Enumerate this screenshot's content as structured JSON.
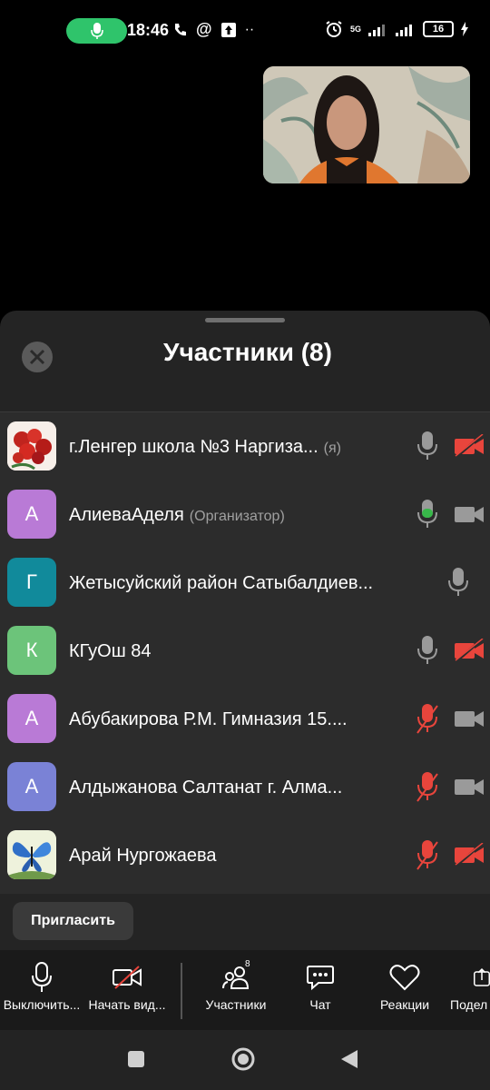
{
  "status_bar": {
    "time": "18:46",
    "battery": "16",
    "network": "5G",
    "recording_mic_color": "#2fc46b"
  },
  "panel": {
    "title": "Участники (8)",
    "close_icon": "close-icon"
  },
  "participants": [
    {
      "name": "г.Ленгер школа №3  Наргиза...",
      "tag": "(я)",
      "avatar_letter": "",
      "avatar_color": "#c0392b",
      "mic": "on",
      "camera": "off"
    },
    {
      "name": "АлиеваАделя",
      "tag": "(Организатор)",
      "avatar_letter": "А",
      "avatar_color": "#b97ad6",
      "mic": "active",
      "camera": "available"
    },
    {
      "name": "Жетысуйский район Сатыбалдиев...",
      "tag": "",
      "avatar_letter": "Г",
      "avatar_color": "#118a9b",
      "mic": "on",
      "camera": "none"
    },
    {
      "name": "КГуОш 84",
      "tag": "",
      "avatar_letter": "К",
      "avatar_color": "#6cc47a",
      "mic": "on",
      "camera": "off"
    },
    {
      "name": "Абубакирова Р.М. Гимназия 15....",
      "tag": "",
      "avatar_letter": "А",
      "avatar_color": "#b97ad6",
      "mic": "muted",
      "camera": "available"
    },
    {
      "name": "Алдыжанова Салтанат г. Алма...",
      "tag": "",
      "avatar_letter": "А",
      "avatar_color": "#7a82d6",
      "mic": "muted",
      "camera": "available"
    },
    {
      "name": "Арай Нургожаева",
      "tag": "",
      "avatar_letter": "",
      "avatar_color": "#d9e3b8",
      "mic": "muted",
      "camera": "off"
    }
  ],
  "invite_label": "Пригласить",
  "toolbar": {
    "mute_label": "Выключить...",
    "video_label": "Начать вид...",
    "participants_label": "Участники",
    "participants_count": "8",
    "chat_label": "Чат",
    "reactions_label": "Реакции",
    "share_label": "Подел"
  },
  "colors": {
    "muted_red": "#e8453c",
    "active_green": "#38b84a",
    "icon_gray": "#9a9a9a"
  }
}
